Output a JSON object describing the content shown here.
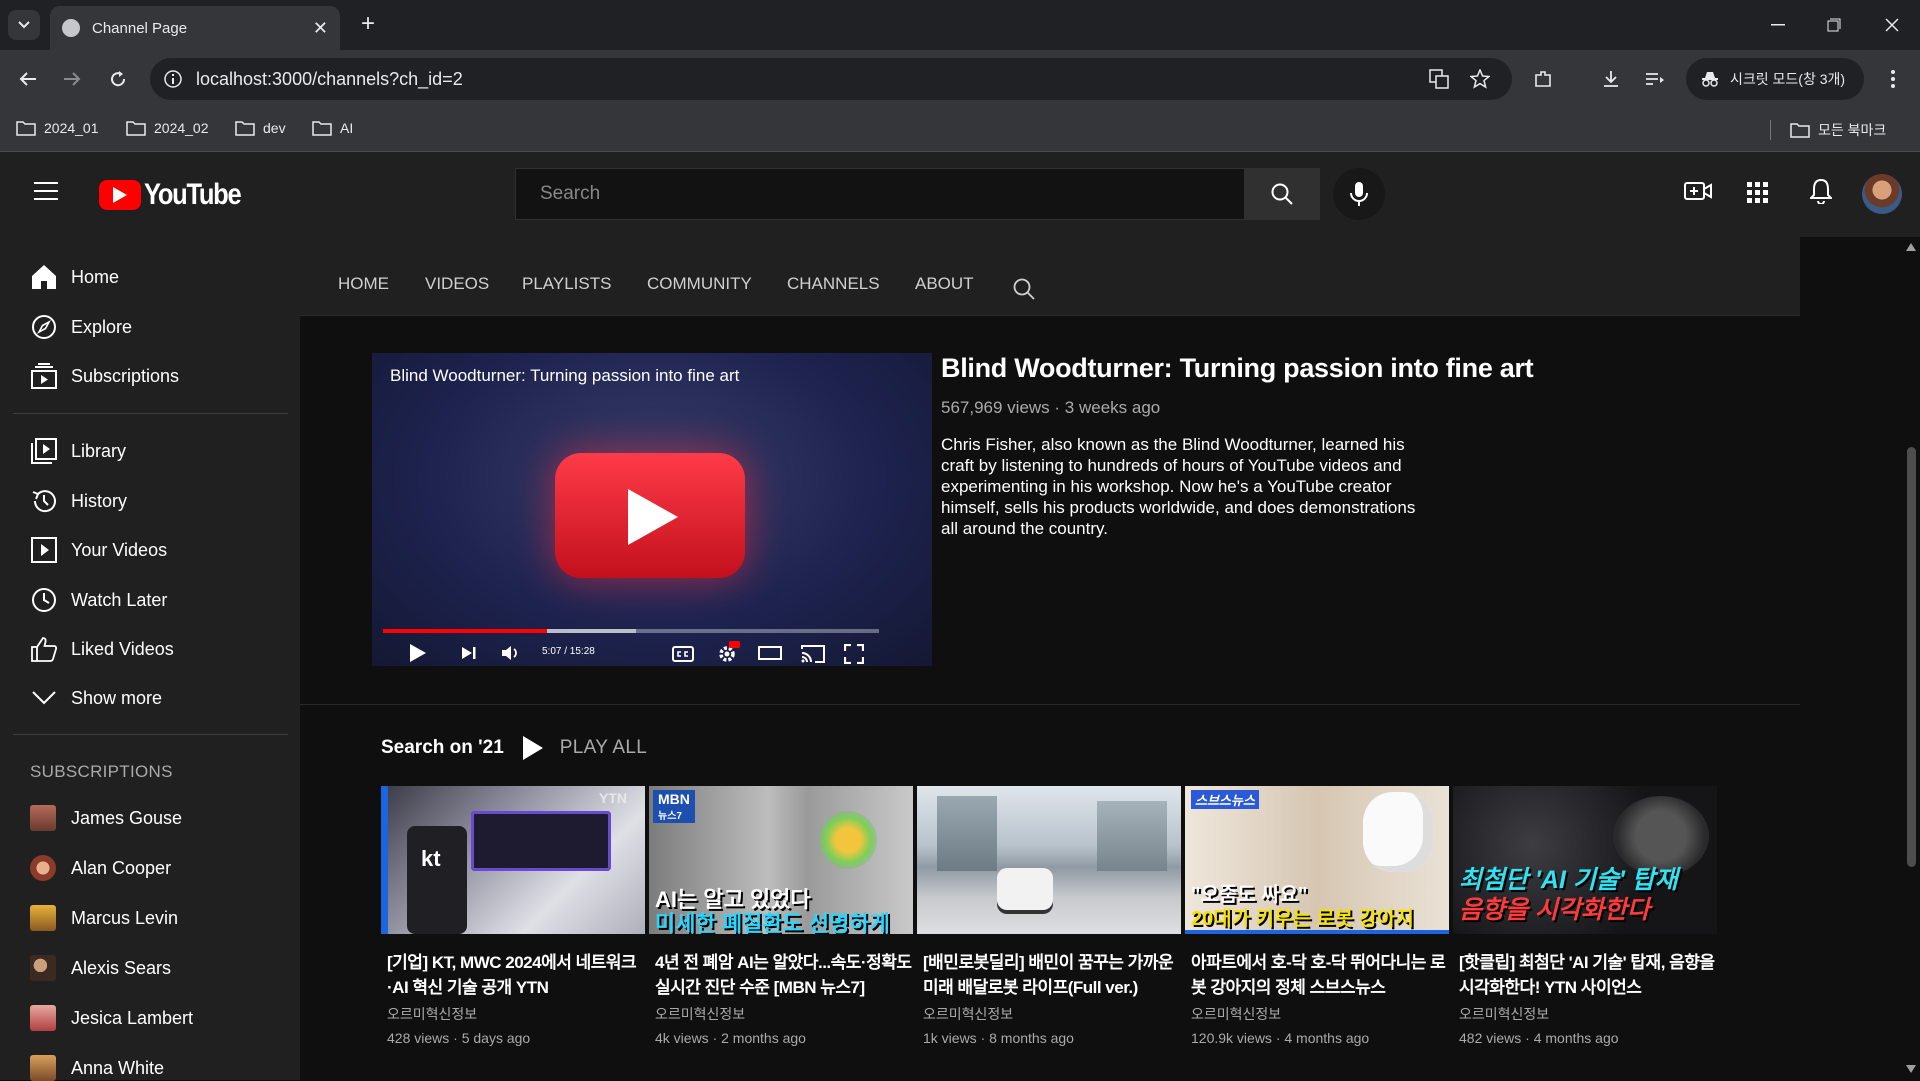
{
  "browser": {
    "tab_title": "Channel Page",
    "url": "localhost:3000/channels?ch_id=2",
    "incognito_label": "시크릿 모드(창 3개)",
    "bookmarks": [
      "2024_01",
      "2024_02",
      "dev",
      "AI"
    ],
    "all_bookmarks": "모든 북마크"
  },
  "header": {
    "logo_text": "YouTube",
    "search_placeholder": "Search"
  },
  "sidebar": {
    "main": [
      "Home",
      "Explore",
      "Subscriptions"
    ],
    "library": [
      "Library",
      "History",
      "Your Videos",
      "Watch Later",
      "Liked Videos",
      "Show more"
    ],
    "subscriptions_heading": "SUBSCRIPTIONS",
    "subscriptions": [
      "James Gouse",
      "Alan Cooper",
      "Marcus Levin",
      "Alexis Sears",
      "Jesica Lambert",
      "Anna White"
    ]
  },
  "channel_nav": [
    "HOME",
    "VIDEOS",
    "PLAYLISTS",
    "COMMUNITY",
    "CHANNELS",
    "ABOUT"
  ],
  "featured": {
    "player_title": "Blind Woodturner: Turning passion into fine art",
    "time": "5:07 / 15:28",
    "progress": 0.33,
    "title": "Blind Woodturner: Turning passion into fine art",
    "meta": "567,969 views · 3 weeks ago",
    "description": "Chris Fisher, also known as the Blind Woodturner, learned his craft by listening to hundreds of hours of YouTube videos and experimenting in his workshop. Now he's a YouTube creator himself, sells his products worldwide, and does demonstrations all around the country."
  },
  "shelf": {
    "title": "Search on '21",
    "play_all": "PLAY ALL",
    "videos": [
      {
        "title": "[기업] KT, MWC 2024에서 네트워크·AI 혁신 기술 공개 YTN",
        "channel": "오르미혁신정보",
        "meta": "428 views · 5 days ago",
        "badge": "YTN",
        "logo": "kt",
        "cap1": "",
        "cap2": ""
      },
      {
        "title": "4년 전 폐암 AI는 알았다...속도·정확도 실시간 진단 수준 [MBN 뉴스7]",
        "channel": "오르미혁신정보",
        "meta": "4k views · 2 months ago",
        "badge": "MBN",
        "badge2": "뉴스7",
        "cap1": "AI는 알고 있었다",
        "cap2": "미세한 폐질환도 선명하게"
      },
      {
        "title": "[배민로봇딜리] 배민이 꿈꾸는 가까운 미래 배달로봇 라이프(Full ver.)",
        "channel": "오르미혁신정보",
        "meta": "1k views · 8 months ago",
        "cap1": "",
        "cap2": ""
      },
      {
        "title": "아파트에서 호-닥 호-닥 뛰어다니는 로봇 강아지의 정체 스브스뉴스",
        "channel": "오르미혁신정보",
        "meta": "120.9k views · 4 months ago",
        "badge": "스브스뉴스",
        "cap1": "\"오줌도 싸요\"",
        "cap2": "20대가 키우는 로봇 강아지"
      },
      {
        "title": "[핫클립] 최첨단 'AI 기술' 탑재, 음향을 시각화한다! YTN 사이언스",
        "channel": "오르미혁신정보",
        "meta": "482 views · 4 months ago",
        "cap1": "최첨단 'AI 기술' 탑재",
        "cap2": "음향을 시각화한다"
      }
    ]
  },
  "colors": {
    "accent": "#ff0000",
    "bg": "#0f0f0f",
    "panel": "#202020"
  }
}
